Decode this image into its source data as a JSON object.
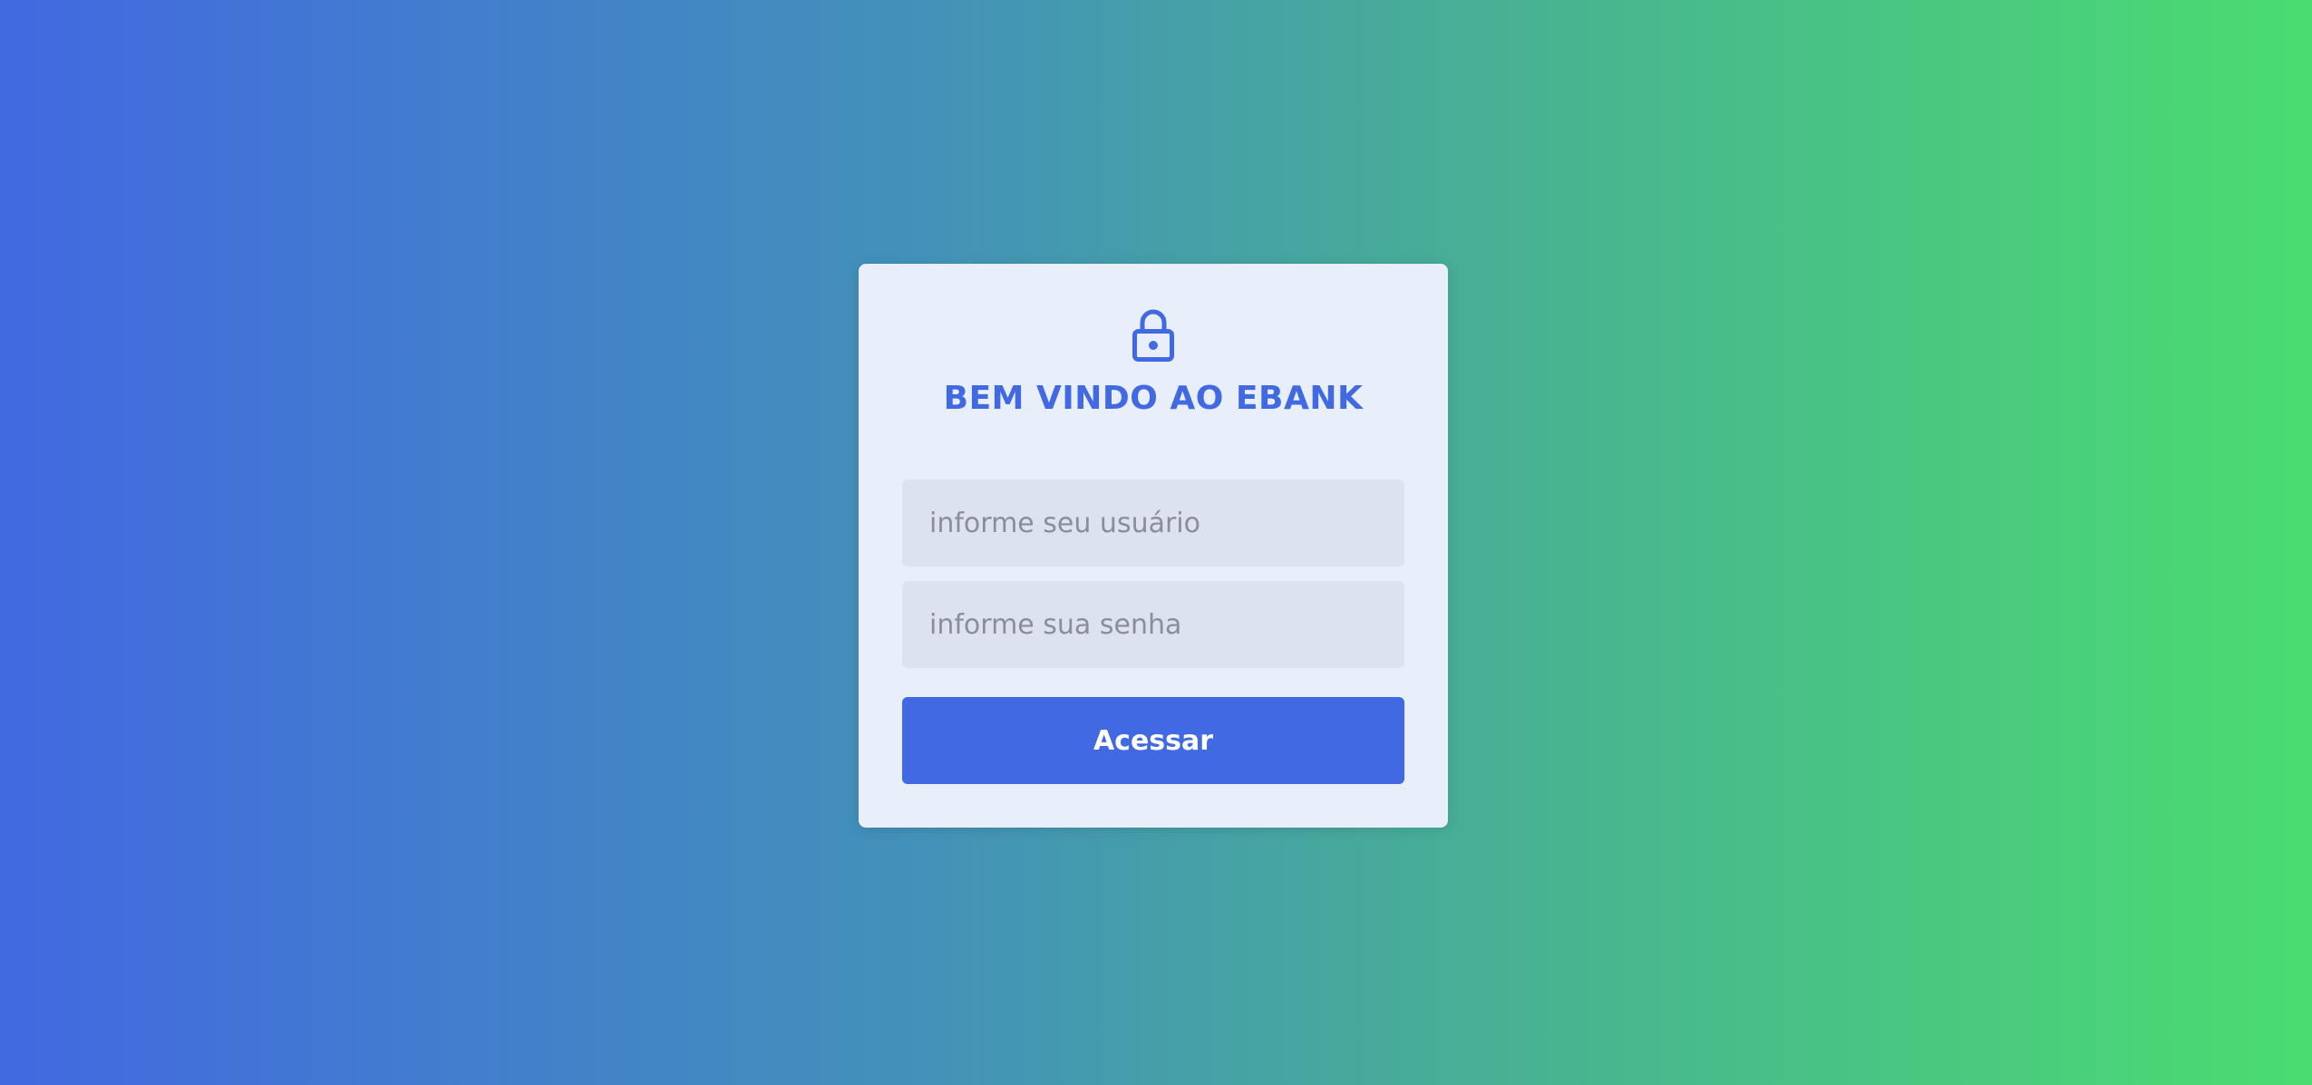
{
  "colors": {
    "accent": "#4169E1",
    "card_background": "#e9effa",
    "input_background": "#dde3ee",
    "gradient_start": "#4169E1",
    "gradient_end": "#4adc70"
  },
  "login": {
    "icon": "lock-icon",
    "title": "BEM VINDO AO EBANK",
    "username": {
      "value": "",
      "placeholder": "informe seu usuário"
    },
    "password": {
      "value": "",
      "placeholder": "informe sua senha"
    },
    "submit_label": "Acessar"
  }
}
